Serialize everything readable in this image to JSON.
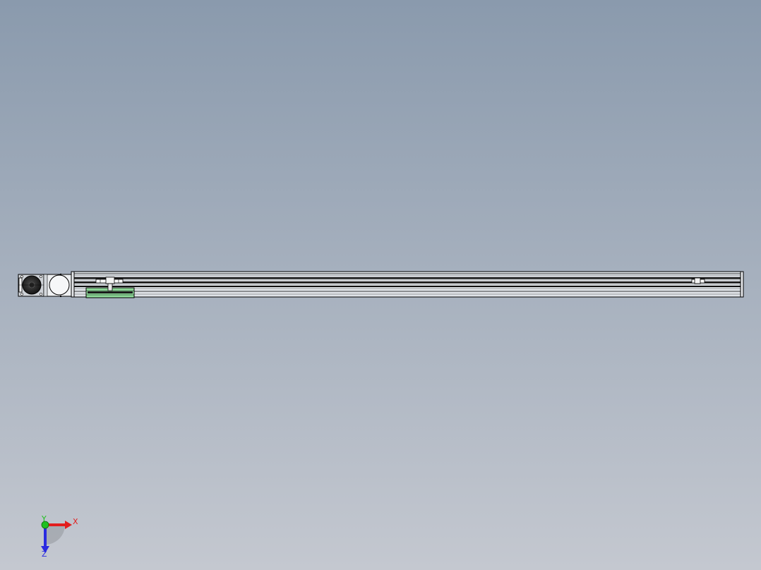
{
  "viewport": {
    "background_top_color": "#8a9aad",
    "background_bottom_color": "#c4c8d0",
    "view_orientation": "top",
    "model": {
      "type": "linear-module",
      "parts": [
        "motor",
        "coupling-housing",
        "rail-profile",
        "carriage",
        "limit-sensor-left",
        "limit-sensor-right"
      ],
      "carriage_color": "#8fdc9a",
      "edge_color": "#000000",
      "body_color": "#dfe3e8"
    }
  },
  "triad": {
    "x_label": "X",
    "y_label": "Y",
    "z_label": "Z",
    "x_color": "#e21e1e",
    "y_color": "#20c020",
    "z_color": "#2a2ae0"
  }
}
